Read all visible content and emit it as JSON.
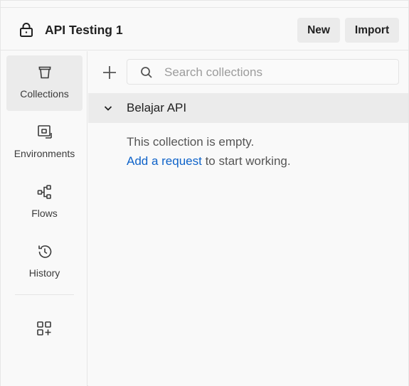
{
  "header": {
    "workspace_title": "API Testing 1",
    "new_label": "New",
    "import_label": "Import"
  },
  "sidebar": {
    "items": [
      {
        "label": "Collections",
        "icon": "collections-icon",
        "active": true
      },
      {
        "label": "Environments",
        "icon": "environments-icon"
      },
      {
        "label": "Flows",
        "icon": "flows-icon"
      },
      {
        "label": "History",
        "icon": "history-icon"
      }
    ],
    "more_icon": "configure-workbench-icon"
  },
  "main": {
    "search": {
      "placeholder": "Search collections",
      "value": ""
    },
    "collection": {
      "name": "Belajar API",
      "expanded": true
    },
    "empty_line1": "This collection is empty.",
    "empty_link": "Add a request",
    "empty_suffix": " to start working."
  },
  "colors": {
    "link": "#0f63c9",
    "active_bg": "#ebebeb",
    "panel_bg": "#f9f9f9"
  }
}
